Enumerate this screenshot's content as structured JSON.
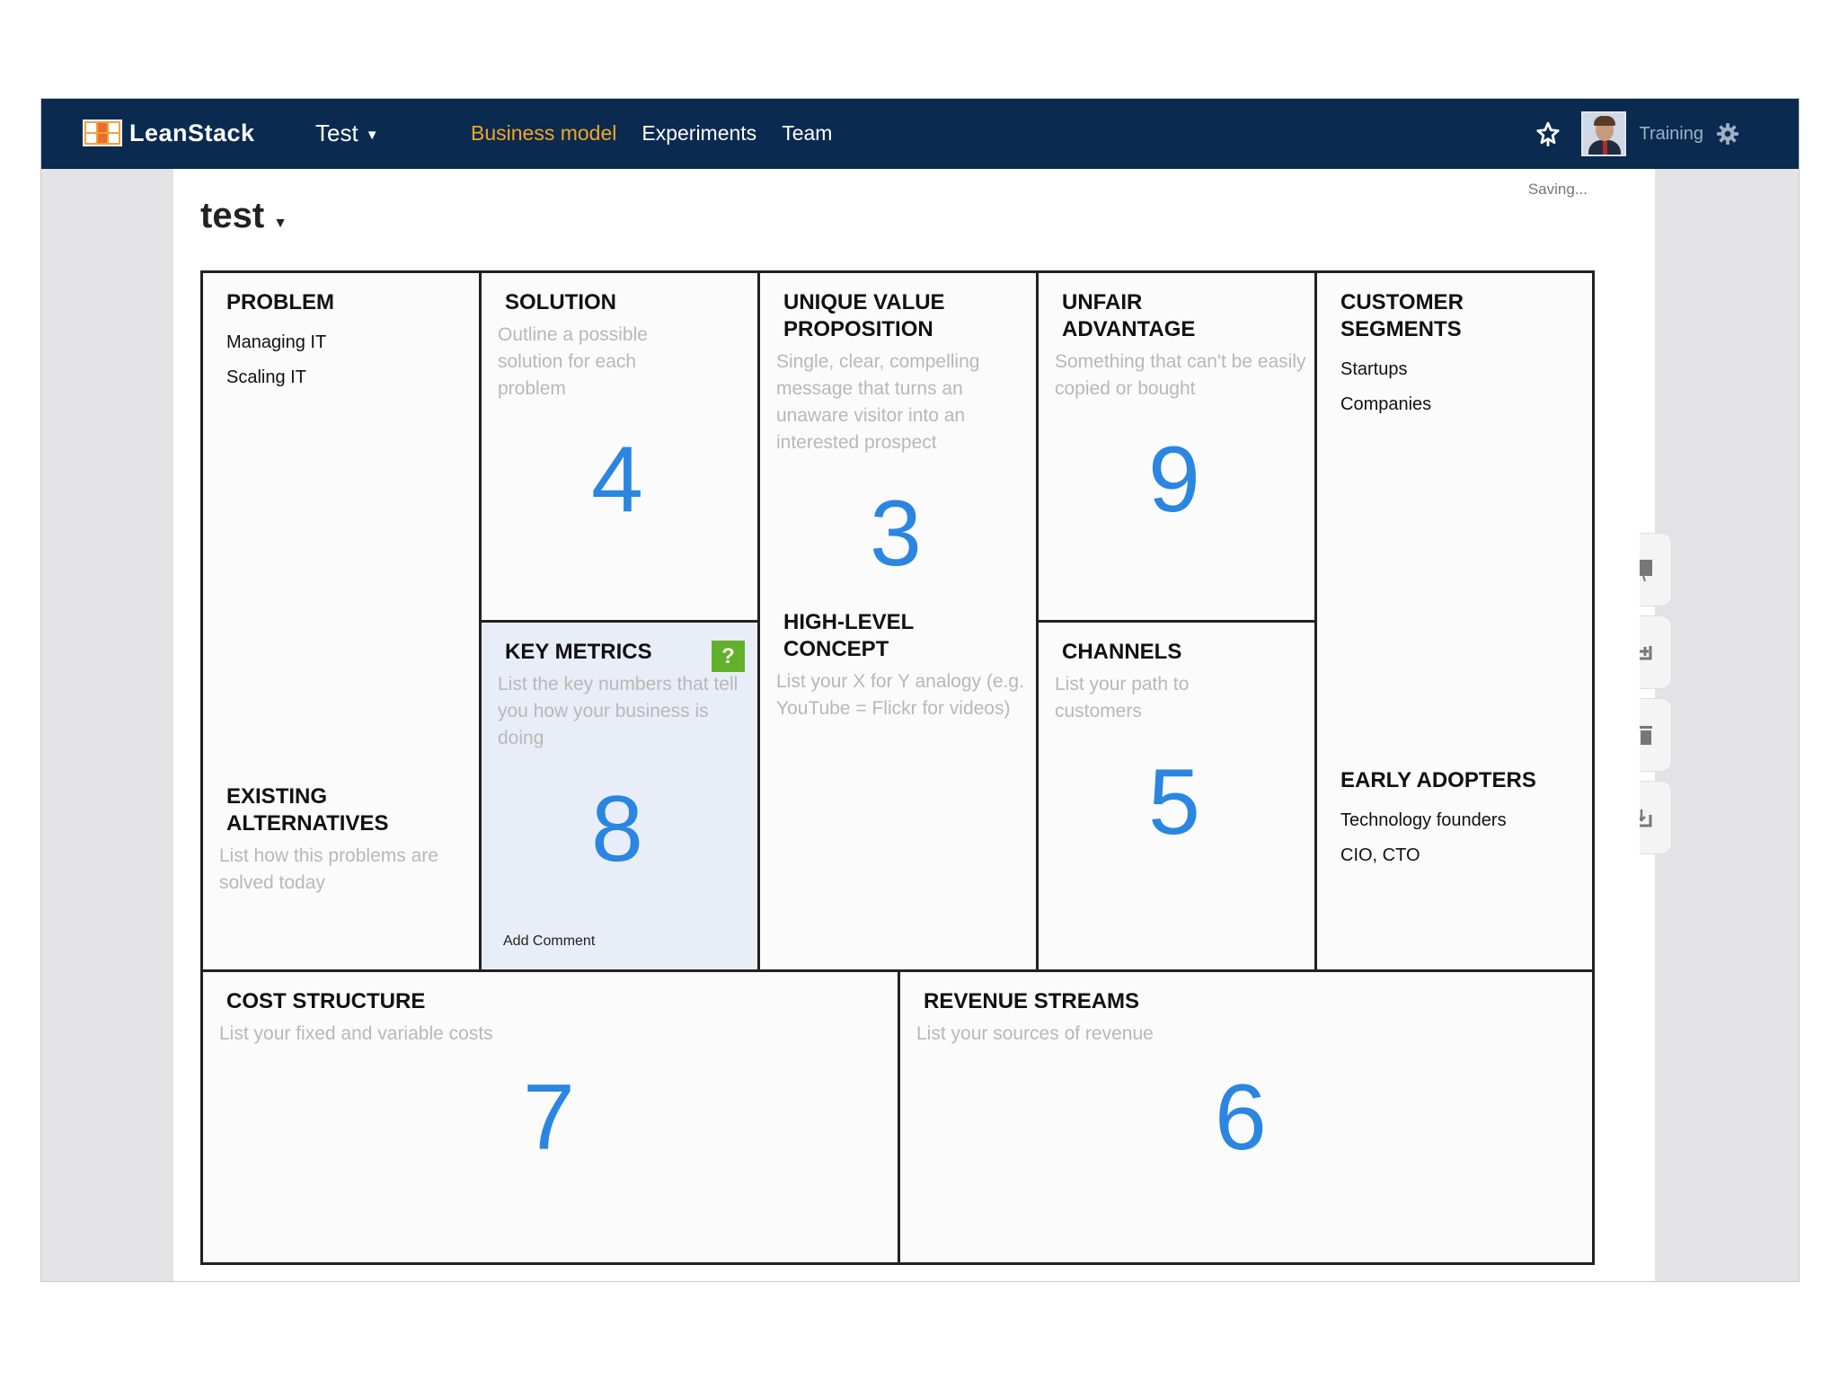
{
  "nav": {
    "logo_text": "LeanStack",
    "project_menu_label": "Test",
    "links": [
      {
        "label": "Business model",
        "active": true
      },
      {
        "label": "Experiments",
        "active": false
      },
      {
        "label": "Team",
        "active": false
      }
    ],
    "user_name": "Training",
    "active_color": "#f5a623",
    "bar_color": "#0a2a50"
  },
  "page": {
    "title": "test",
    "status": "Saving..."
  },
  "canvas": {
    "number_color": "#2a86e0",
    "problem": {
      "heading": "PROBLEM",
      "items": [
        "Managing IT",
        "Scaling IT"
      ],
      "alternatives": {
        "heading": "EXISTING ALTERNATIVES",
        "hint": "List how this problems are solved today"
      }
    },
    "solution": {
      "heading": "SOLUTION",
      "hint": "Outline a possible solution for each problem",
      "number": "4"
    },
    "key_metrics": {
      "heading": "KEY METRICS",
      "hint": "List the key numbers that tell you how your business is doing",
      "number": "8",
      "help_label": "?",
      "add_comment": "Add Comment"
    },
    "uvp": {
      "heading": "UNIQUE VALUE PROPOSITION",
      "hint": "Single, clear, compelling message that turns an unaware visitor into an interested prospect",
      "number": "3",
      "high_level": {
        "heading": "HIGH-LEVEL CONCEPT",
        "hint": "List your X for Y analogy (e.g. YouTube = Flickr for videos)"
      }
    },
    "unfair_advantage": {
      "heading": "UNFAIR ADVANTAGE",
      "hint": "Something that can't be easily copied or bought",
      "number": "9"
    },
    "channels": {
      "heading": "CHANNELS",
      "hint": "List your path to customers",
      "number": "5"
    },
    "customer_segments": {
      "heading": "CUSTOMER SEGMENTS",
      "items": [
        "Startups",
        "Companies"
      ],
      "early_adopters": {
        "heading": "EARLY ADOPTERS",
        "items": [
          "Technology founders",
          "CIO, CTO"
        ]
      }
    },
    "cost_structure": {
      "heading": "COST STRUCTURE",
      "hint": "List your fixed and variable costs",
      "number": "7"
    },
    "revenue_streams": {
      "heading": "REVENUE STREAMS",
      "hint": "List your sources of revenue",
      "number": "6"
    }
  },
  "side_tools": [
    "bookmark-icon",
    "add-icon",
    "trash-icon",
    "export-icon"
  ]
}
